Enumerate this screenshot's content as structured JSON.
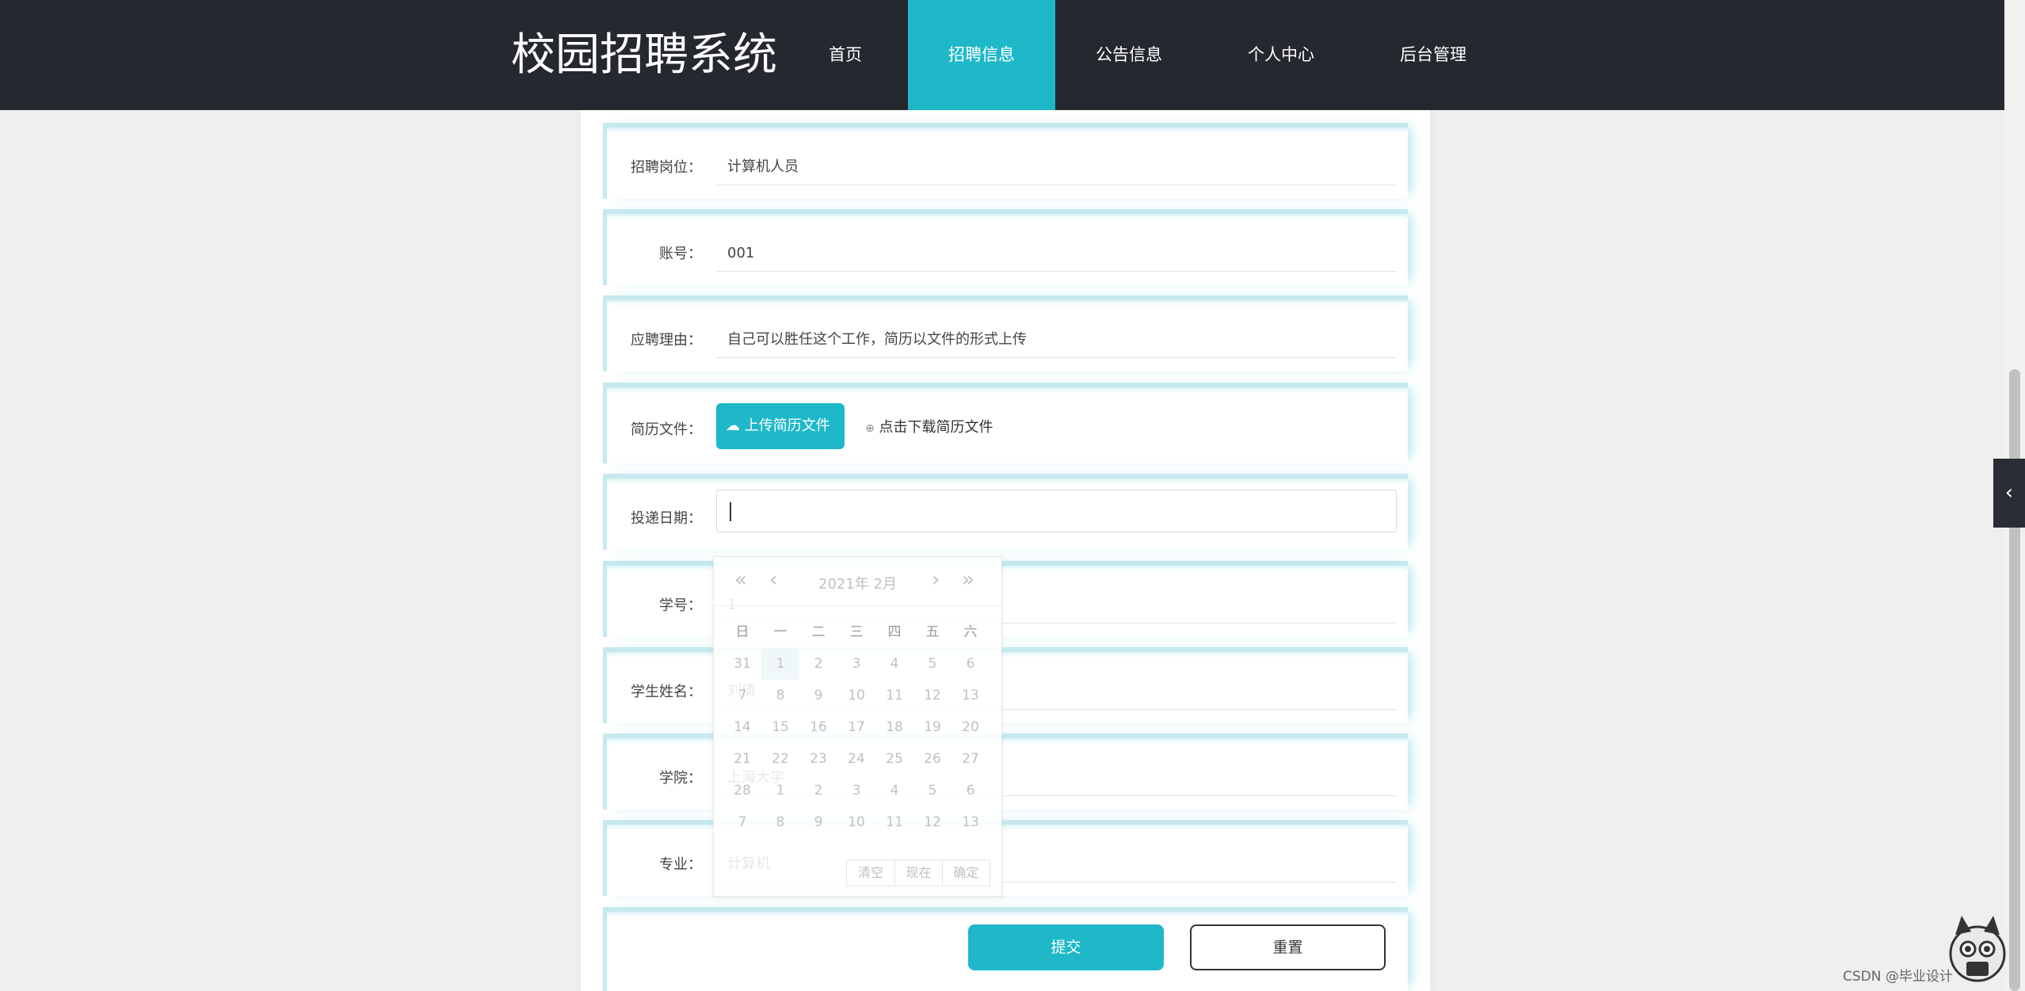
{
  "header": {
    "brand": "校园招聘系统",
    "nav": [
      "首页",
      "招聘信息",
      "公告信息",
      "个人中心",
      "后台管理"
    ],
    "active_index": 1
  },
  "form": {
    "position": {
      "label": "招聘岗位：",
      "value": "计算机人员"
    },
    "account": {
      "label": "账号：",
      "value": "001"
    },
    "reason": {
      "label": "应聘理由：",
      "value": "自己可以胜任这个工作，简历以文件的形式上传"
    },
    "resume": {
      "label": "简历文件：",
      "upload_label": "上传简历文件",
      "download_label": "点击下载简历文件"
    },
    "date": {
      "label": "投递日期：",
      "value": ""
    },
    "student_id": {
      "label": "学号：",
      "value": "1"
    },
    "student_name": {
      "label": "学生姓名：",
      "value": "刘倩"
    },
    "college": {
      "label": "学院：",
      "value": "上海大学"
    },
    "major": {
      "label": "专业：",
      "value": "计算机"
    },
    "submit_label": "提交",
    "reset_label": "重置"
  },
  "calendar": {
    "title": "2021年  2月",
    "weekdays": [
      "日",
      "一",
      "二",
      "三",
      "四",
      "五",
      "六"
    ],
    "days": [
      [
        "31",
        "1",
        "2",
        "3",
        "4",
        "5",
        "6"
      ],
      [
        "7",
        "8",
        "9",
        "10",
        "11",
        "12",
        "13"
      ],
      [
        "14",
        "15",
        "16",
        "17",
        "18",
        "19",
        "20"
      ],
      [
        "21",
        "22",
        "23",
        "24",
        "25",
        "26",
        "27"
      ],
      [
        "28",
        "1",
        "2",
        "3",
        "4",
        "5",
        "6"
      ],
      [
        "7",
        "8",
        "9",
        "10",
        "11",
        "12",
        "13"
      ]
    ],
    "selected": {
      "row": 0,
      "col": 1
    },
    "clear_label": "清空",
    "now_label": "现在",
    "confirm_label": "确定"
  },
  "watermark": "CSDN @毕业设计",
  "colors": {
    "accent": "#1fb8c9",
    "nav_bg": "#25282e"
  }
}
